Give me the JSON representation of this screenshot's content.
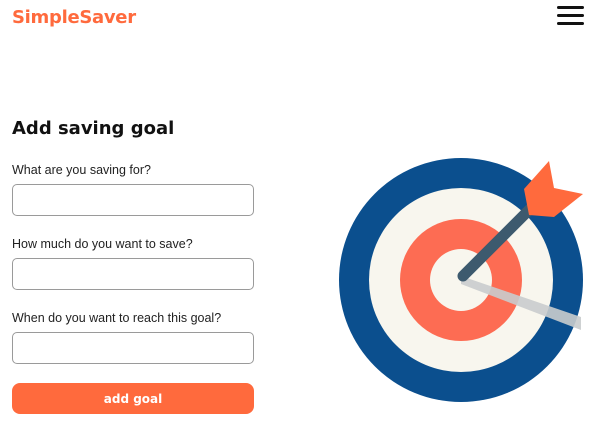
{
  "header": {
    "brand": "SimpleSaver",
    "menu_icon": "hamburger-menu-icon"
  },
  "form": {
    "title": "Add saving goal",
    "fields": [
      {
        "label": "What are you saving for?",
        "value": "",
        "placeholder": ""
      },
      {
        "label": "How much do you want to save?",
        "value": "",
        "placeholder": ""
      },
      {
        "label": "When do you want to reach this goal?",
        "value": "",
        "placeholder": ""
      }
    ],
    "submit_label": "add goal"
  },
  "illustration": {
    "icon": "target-with-arrow-illustration",
    "colors": {
      "outer_ring": "#0b4f8e",
      "cream_ring": "#f8f6ee",
      "red_ring": "#fd6c53",
      "arrow_shaft": "#3d5a6e",
      "fletching": "#ff6a3d",
      "shadow": "#c9cccd"
    }
  },
  "colors": {
    "accent": "#ff6a3d",
    "text": "#111111",
    "input_border": "#9a9a9a"
  }
}
